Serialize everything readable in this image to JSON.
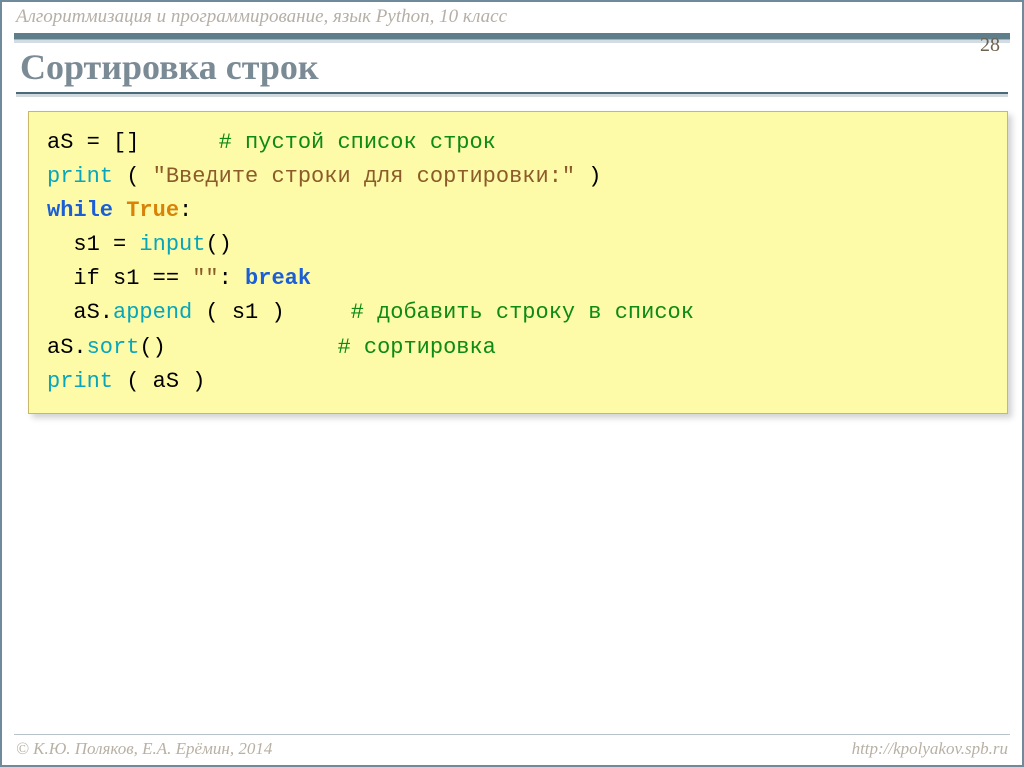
{
  "header": "Алгоритмизация и программирование, язык Python, 10 класс",
  "page_number": "28",
  "title": "Сортировка строк",
  "code": {
    "l1a": "aS = []",
    "l1b": "      # пустой список строк",
    "l2a": "print",
    "l2b": " ( ",
    "l2c": "\"Введите строки для сортировки:\"",
    "l2d": " )",
    "l3a": "while",
    "l3b": " ",
    "l3c": "True",
    "l3d": ":",
    "l4a": "  s1 = ",
    "l4b": "input",
    "l4c": "()",
    "l5a": "  if s1 == ",
    "l5b": "\"\"",
    "l5c": ": ",
    "l5d": "break",
    "l6a": "  aS.",
    "l6b": "append",
    "l6c": " ( s1 )",
    "l6d": "     # добавить строку в список",
    "l7a": "aS.",
    "l7b": "sort",
    "l7c": "()",
    "l7d": "             # сортировка",
    "l8a": "print",
    "l8b": " ( aS )"
  },
  "footer_left": "© К.Ю. Поляков, Е.А. Ерёмин, 2014",
  "footer_right": "http://kpolyakov.spb.ru"
}
